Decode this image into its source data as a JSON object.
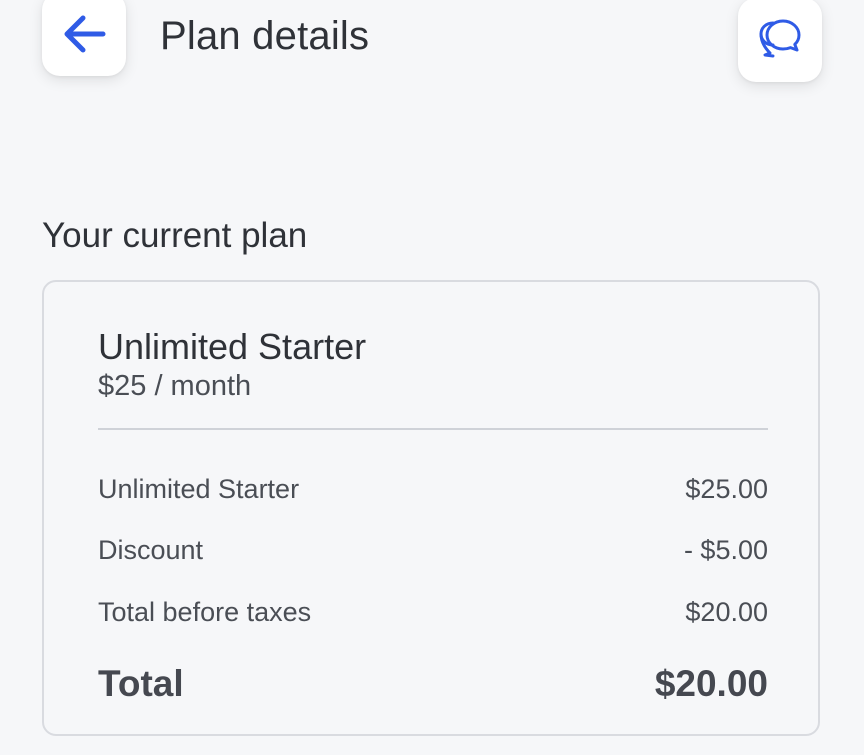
{
  "header": {
    "title": "Plan details",
    "back_icon": "arrow-left-icon",
    "chat_icon": "chat-bubbles-icon"
  },
  "section": {
    "title": "Your current plan"
  },
  "plan": {
    "name": "Unlimited Starter",
    "price": "$25 / month",
    "line_items": [
      {
        "label": "Unlimited Starter",
        "value": "$25.00"
      },
      {
        "label": "Discount",
        "value": "- $5.00"
      },
      {
        "label": "Total before taxes",
        "value": "$20.00"
      }
    ],
    "total": {
      "label": "Total",
      "value": "$20.00"
    }
  },
  "colors": {
    "accent": "#2f5be6",
    "background": "#f6f7f9",
    "card_border": "#d9dbe0",
    "text_primary": "#2f3238"
  }
}
